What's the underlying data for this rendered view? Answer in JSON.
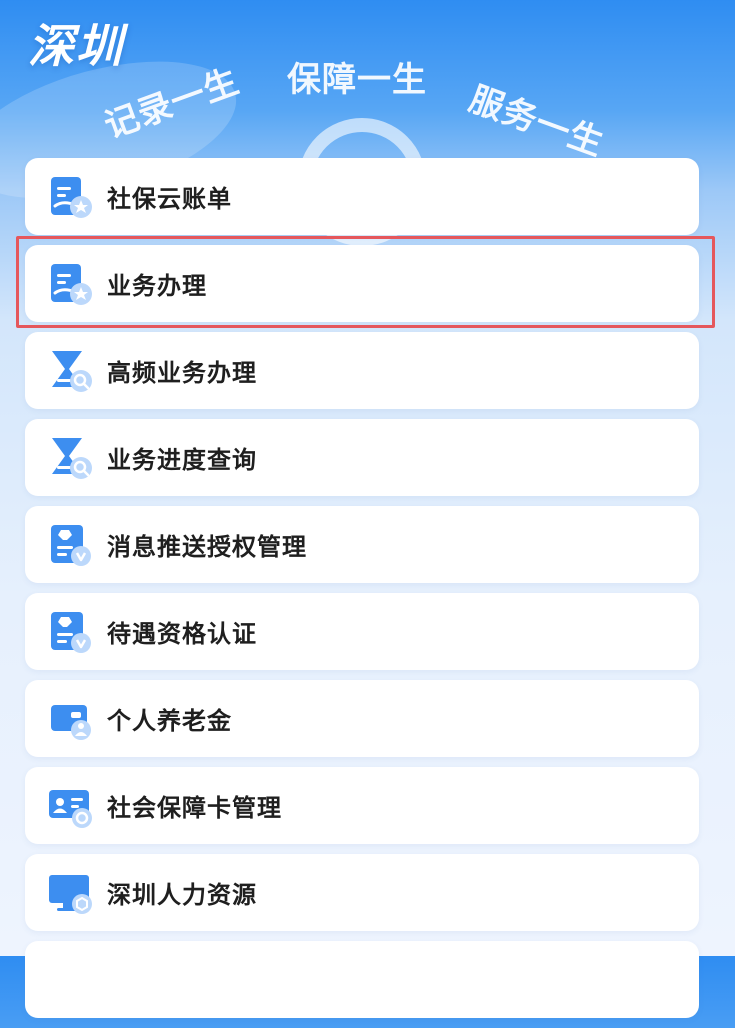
{
  "header": {
    "city": "深圳",
    "slogans": [
      "记录一生",
      "保障一生",
      "服务一生"
    ]
  },
  "menu": {
    "items": [
      {
        "label": "社保云账单",
        "icon": "bill-icon"
      },
      {
        "label": "业务办理",
        "icon": "bill-icon"
      },
      {
        "label": "高频业务办理",
        "icon": "hourglass-search-icon"
      },
      {
        "label": "业务进度查询",
        "icon": "hourglass-search-icon"
      },
      {
        "label": "消息推送授权管理",
        "icon": "document-badge-icon"
      },
      {
        "label": "待遇资格认证",
        "icon": "document-badge-icon"
      },
      {
        "label": "个人养老金",
        "icon": "wallet-person-icon"
      },
      {
        "label": "社会保障卡管理",
        "icon": "card-icon"
      },
      {
        "label": "深圳人力资源",
        "icon": "monitor-icon"
      }
    ]
  },
  "highlight": {
    "target": "业务办理",
    "color": "#e5575c"
  },
  "colors": {
    "accent": "#2f8df2",
    "icon_blue": "#3d8ef0"
  }
}
